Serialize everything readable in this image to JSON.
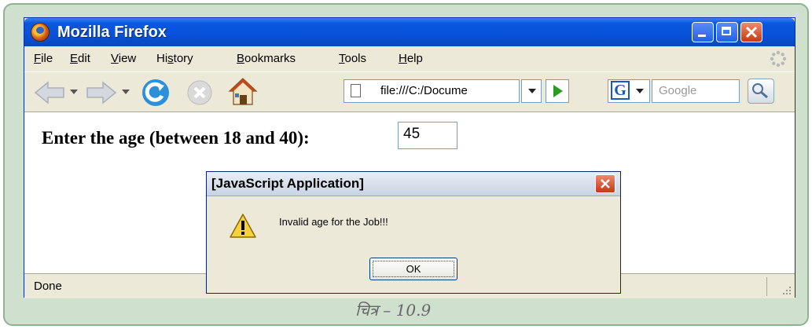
{
  "window": {
    "title": "Mozilla Firefox"
  },
  "menu": [
    "File",
    "Edit",
    "View",
    "History",
    "Bookmarks",
    "Tools",
    "Help"
  ],
  "menu_accel": [
    "F",
    "E",
    "V",
    "s",
    "B",
    "T",
    "H"
  ],
  "toolbar": {
    "url": "file:///C:/Docume",
    "search_placeholder": "Google",
    "search_engine": "G"
  },
  "page": {
    "prompt": "Enter the age (between 18 and 40):",
    "age_value": "45"
  },
  "status": {
    "text": "Done"
  },
  "dialog": {
    "title": "[JavaScript Application]",
    "message": "Invalid age for the Job!!!",
    "ok_label": "OK"
  },
  "caption": "चित्र – 10.9",
  "colors": {
    "titlebar": "#0752d8",
    "close_red": "#c43a14",
    "frame_green": "#cfe0cf"
  }
}
